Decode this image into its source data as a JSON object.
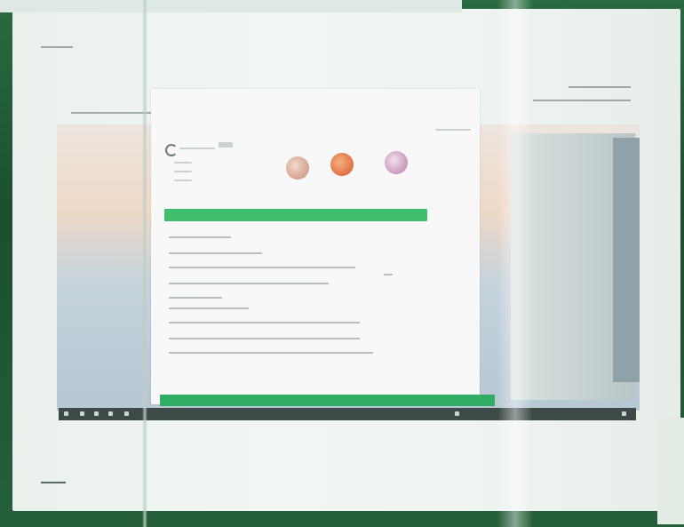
{
  "scene": {
    "description_colors": {
      "surround": "#1f5a35",
      "board": "#eef3ef",
      "accent_green": "#3fbf6b",
      "taskbar": "#3d4a48"
    },
    "icons": [
      "browser-logo-icon",
      "orb-icon",
      "taskbar-icon"
    ]
  }
}
